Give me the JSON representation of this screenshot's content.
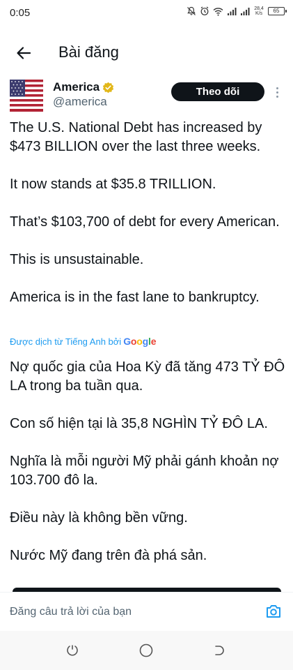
{
  "status": {
    "time": "0:05",
    "net_speed_value": "28,4",
    "net_speed_unit": "K/s",
    "battery": "65"
  },
  "header": {
    "title": "Bài đăng"
  },
  "post": {
    "author_name": "America",
    "author_handle": "@america",
    "follow_label": "Theo dõi",
    "paragraphs": [
      "The U.S. National Debt has increased by $473 BILLION over the last three weeks.",
      "It now stands at $35.8 TRILLION.",
      "That’s $103,700 of debt for every American.",
      "This is unsustainable.",
      "America is in the fast lane to bankruptcy."
    ],
    "translated_by": "Được dịch từ Tiếng Anh bởi",
    "translator_brand": "Google",
    "translated_paragraphs": [
      "Nợ quốc gia của Hoa Kỳ đã tăng 473 TỶ ĐÔ LA trong ba tuần qua.",
      "Con số hiện tại là 35,8 NGHÌN TỶ ĐÔ LA.",
      "Nghĩa là mỗi người Mỹ phải gánh khoản nợ 103.700 đô la.",
      "Điều này là không bền vững.",
      "Nước Mỹ đang trên đà phá sản."
    ]
  },
  "reply": {
    "placeholder": "Đăng câu trả lời của bạn"
  },
  "colors": {
    "accent": "#1d9bf0",
    "text": "#0f1419",
    "muted": "#536471",
    "verified_gold": "#e2b719"
  }
}
